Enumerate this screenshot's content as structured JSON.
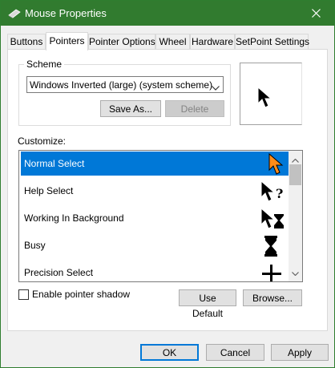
{
  "window": {
    "title": "Mouse Properties",
    "titlebar_color": "#317b2f"
  },
  "tabs": [
    {
      "label": "Buttons",
      "active": false
    },
    {
      "label": "Pointers",
      "active": true
    },
    {
      "label": "Pointer Options",
      "active": false
    },
    {
      "label": "Wheel",
      "active": false
    },
    {
      "label": "Hardware",
      "active": false
    },
    {
      "label": "SetPoint Settings",
      "active": false
    }
  ],
  "scheme": {
    "group_label": "Scheme",
    "selected": "Windows Inverted (large) (system scheme)",
    "save_as_label": "Save As...",
    "delete_label": "Delete"
  },
  "preview_icon": "arrow-pointer-icon",
  "customize": {
    "label": "Customize:",
    "items": [
      {
        "label": "Normal Select",
        "icon": "arrow-pointer-icon",
        "selected": true
      },
      {
        "label": "Help Select",
        "icon": "help-pointer-icon",
        "selected": false
      },
      {
        "label": "Working In Background",
        "icon": "working-pointer-icon",
        "selected": false
      },
      {
        "label": "Busy",
        "icon": "hourglass-icon",
        "selected": false
      },
      {
        "label": "Precision Select",
        "icon": "crosshair-icon",
        "selected": false
      }
    ]
  },
  "shadow": {
    "label": "Enable pointer shadow",
    "checked": false
  },
  "buttons": {
    "use_default": "Use Default",
    "browse": "Browse...",
    "ok": "OK",
    "cancel": "Cancel",
    "apply": "Apply"
  },
  "colors": {
    "selection": "#0078d7",
    "selected_cursor": "#ff8c1a"
  }
}
